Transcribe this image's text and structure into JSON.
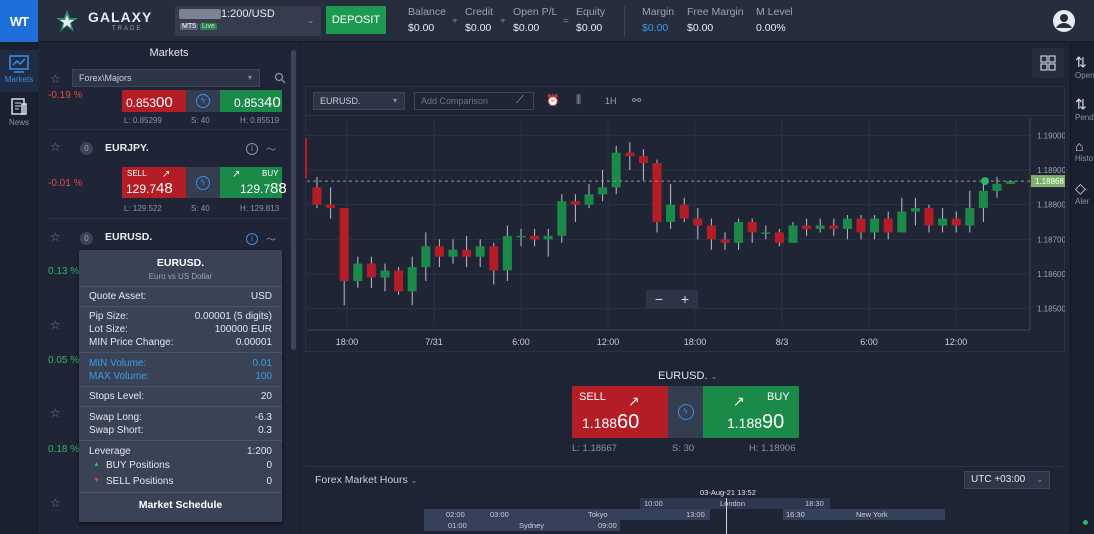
{
  "brand": {
    "badge": "WT",
    "name": "GALAXY",
    "sub": "TRADE"
  },
  "account": {
    "leverage": "1:200/USD",
    "platform": "MT5",
    "status": "Live"
  },
  "deposit_label": "DEPOSIT",
  "stats": [
    {
      "label": "Balance",
      "value": "$0.00"
    },
    {
      "label": "Credit",
      "value": "$0.00"
    },
    {
      "label": "Open P/L",
      "value": "$0.00"
    },
    {
      "label": "Equity",
      "value": "$0.00"
    },
    {
      "label": "Margin",
      "value": "$0.00"
    },
    {
      "label": "Free Margin",
      "value": "$0.00"
    },
    {
      "label": "M Level",
      "value": "0.00%"
    }
  ],
  "operators": [
    "+",
    "+",
    "="
  ],
  "leftnav": {
    "markets": "Markets",
    "news": "News"
  },
  "markets": {
    "title": "Markets",
    "group": "Forex\\Majors",
    "rows": [
      {
        "change": "-0.19 %",
        "sell": {
          "main": "0.853",
          "big": "00"
        },
        "buy": {
          "main": "0.853",
          "big": "40"
        },
        "low": "L: 0.85299",
        "spread": "S: 40",
        "high": "H: 0.85519"
      },
      {
        "badge": "0",
        "name": "EURJPY.",
        "change": "-0.01 %",
        "sell_label": "SELL",
        "buy_label": "BUY",
        "sell": {
          "main": "129.7",
          "big": "48"
        },
        "buy": {
          "main": "129.7",
          "big": "88"
        },
        "low": "L: 129.522",
        "spread": "S: 40",
        "high": "H: 129.813"
      },
      {
        "badge": "0",
        "name": "EURUSD.",
        "info": "i"
      }
    ],
    "hidden_changes": [
      "0.13 %",
      "0.05 %",
      "0.18 %"
    ]
  },
  "popup": {
    "title": "EURUSD.",
    "subtitle": "Euro vs US Dollar",
    "quote_asset_label": "Quote Asset:",
    "quote_asset": "USD",
    "pip_size_label": "Pip Size:",
    "pip_size": "0.00001 (5 digits)",
    "lot_size_label": "Lot Size:",
    "lot_size": "100000 EUR",
    "min_change_label": "MIN Price Change:",
    "min_change": "0.00001",
    "min_volume_label": "MIN Volume:",
    "min_volume": "0.01",
    "max_volume_label": "MAX Volume:",
    "max_volume": "100",
    "stops_label": "Stops Level:",
    "stops": "20",
    "swap_long_label": "Swap Long:",
    "swap_long": "-6.3",
    "swap_short_label": "Swap Short:",
    "swap_short": "0.3",
    "leverage_label": "Leverage",
    "leverage": "1:200",
    "buy_pos_label": "BUY Positions",
    "buy_pos": "0",
    "sell_pos_label": "SELL Positions",
    "sell_pos": "0",
    "schedule": "Market Schedule"
  },
  "chart_toolbar": {
    "symbol": "EURUSD.",
    "compare_placeholder": "Add Comparison",
    "interval": "1H"
  },
  "chart_data": {
    "type": "candlestick",
    "y_ticks": [
      "1.19000",
      "1.18900",
      "1.18800",
      "1.18700",
      "1.18600",
      "1.18500"
    ],
    "y_range": [
      1.1845,
      1.1905
    ],
    "x_ticks": [
      "18:00",
      "7/31",
      "6:00",
      "12:00",
      "18:00",
      "8/3",
      "6:00",
      "12:00"
    ],
    "current_price": "1.18868",
    "candles": [
      [
        1.1885,
        1.188,
        1.1888,
        1.1879
      ],
      [
        1.188,
        1.1879,
        1.1885,
        1.1876
      ],
      [
        1.1879,
        1.1858,
        1.1879,
        1.1851
      ],
      [
        1.1858,
        1.1863,
        1.1865,
        1.1856
      ],
      [
        1.1863,
        1.1859,
        1.1865,
        1.1856
      ],
      [
        1.1859,
        1.1861,
        1.1863,
        1.1855
      ],
      [
        1.1861,
        1.1855,
        1.1862,
        1.1854
      ],
      [
        1.1855,
        1.1862,
        1.1865,
        1.1851
      ],
      [
        1.1862,
        1.1868,
        1.1872,
        1.1858
      ],
      [
        1.1868,
        1.1865,
        1.187,
        1.1862
      ],
      [
        1.1865,
        1.1867,
        1.187,
        1.1863
      ],
      [
        1.1867,
        1.1865,
        1.1871,
        1.1862
      ],
      [
        1.1865,
        1.1868,
        1.187,
        1.1862
      ],
      [
        1.1868,
        1.1861,
        1.1869,
        1.1857
      ],
      [
        1.1861,
        1.1871,
        1.1874,
        1.1858
      ],
      [
        1.1871,
        1.1871,
        1.1873,
        1.1868
      ],
      [
        1.1871,
        1.187,
        1.1873,
        1.1868
      ],
      [
        1.187,
        1.1871,
        1.1873,
        1.1865
      ],
      [
        1.1871,
        1.1881,
        1.1883,
        1.1869
      ],
      [
        1.1881,
        1.188,
        1.1883,
        1.1875
      ],
      [
        1.188,
        1.1883,
        1.1886,
        1.1879
      ],
      [
        1.1883,
        1.1885,
        1.189,
        1.1881
      ],
      [
        1.1885,
        1.1895,
        1.1897,
        1.1883
      ],
      [
        1.1895,
        1.1894,
        1.1898,
        1.189
      ],
      [
        1.1894,
        1.1892,
        1.1896,
        1.1887
      ],
      [
        1.1892,
        1.1875,
        1.1893,
        1.1872
      ],
      [
        1.1875,
        1.188,
        1.1886,
        1.1873
      ],
      [
        1.188,
        1.1876,
        1.1882,
        1.1875
      ],
      [
        1.1876,
        1.1874,
        1.1879,
        1.187
      ],
      [
        1.1874,
        1.187,
        1.1876,
        1.1867
      ],
      [
        1.187,
        1.1869,
        1.1872,
        1.1867
      ],
      [
        1.1869,
        1.1875,
        1.1876,
        1.1867
      ],
      [
        1.1875,
        1.1872,
        1.1876,
        1.1869
      ],
      [
        1.1872,
        1.1872,
        1.1874,
        1.187
      ],
      [
        1.1872,
        1.1869,
        1.1873,
        1.1868
      ],
      [
        1.1869,
        1.1874,
        1.1875,
        1.187
      ],
      [
        1.1874,
        1.1873,
        1.1876,
        1.1871
      ],
      [
        1.1873,
        1.1874,
        1.1876,
        1.1872
      ],
      [
        1.1874,
        1.1873,
        1.1876,
        1.1871
      ],
      [
        1.1873,
        1.1876,
        1.1877,
        1.187
      ],
      [
        1.1876,
        1.1872,
        1.1877,
        1.187
      ],
      [
        1.1872,
        1.1876,
        1.1877,
        1.187
      ],
      [
        1.1876,
        1.1872,
        1.1878,
        1.187
      ],
      [
        1.1872,
        1.1878,
        1.1882,
        1.1872
      ],
      [
        1.1878,
        1.1879,
        1.1882,
        1.1874
      ],
      [
        1.1879,
        1.1874,
        1.188,
        1.1872
      ],
      [
        1.1874,
        1.1876,
        1.1879,
        1.1872
      ],
      [
        1.1876,
        1.1874,
        1.1878,
        1.1872
      ],
      [
        1.1874,
        1.1879,
        1.1884,
        1.1872
      ],
      [
        1.1879,
        1.1884,
        1.1886,
        1.1875
      ],
      [
        1.1884,
        1.1886,
        1.1888,
        1.1882
      ],
      [
        1.1886,
        1.18868,
        1.1887,
        1.1886
      ]
    ]
  },
  "trade": {
    "symbol": "EURUSD.",
    "sell_label": "SELL",
    "buy_label": "BUY",
    "sell": {
      "main": "1.188",
      "big": "60"
    },
    "buy": {
      "main": "1.188",
      "big": "90"
    },
    "low": "L: 1.18667",
    "spread": "S: 30",
    "high": "H: 1.18906"
  },
  "hours": {
    "title": "Forex Market Hours",
    "tz": "UTC +03:00",
    "now": "03-Aug-21 13:52",
    "sessions": [
      {
        "name": "London",
        "open": "10:00",
        "close": "18:30"
      },
      {
        "name": "New York",
        "open": "16:30",
        "close": ""
      },
      {
        "name": "Tokyo",
        "open": "03:00",
        "close": "13:00"
      },
      {
        "name": "Sydney",
        "open": "01:00",
        "close": "09:00"
      }
    ],
    "extra_times": [
      "02:00"
    ]
  },
  "rightnav": [
    "Open",
    "Pend",
    "Histo",
    "Aler"
  ],
  "colors": {
    "bull": "#1b8a49",
    "bear": "#b41d25",
    "accent": "#3a8ee8",
    "current": "#2fb46a"
  }
}
